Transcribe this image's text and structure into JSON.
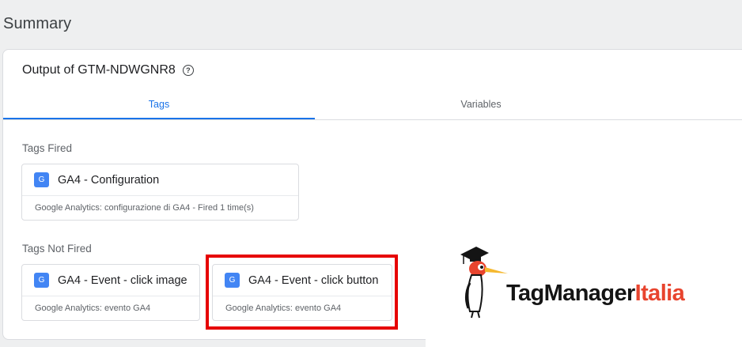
{
  "page_title": "Summary",
  "panel": {
    "header": "Output of GTM-NDWGNR8",
    "help_icon": "help-circle-icon"
  },
  "tabs": [
    {
      "label": "Tags",
      "active": true
    },
    {
      "label": "Variables",
      "active": false
    }
  ],
  "tags_fired": {
    "label": "Tags Fired",
    "items": [
      {
        "icon": "G",
        "name": "GA4 - Configuration",
        "subtitle": "Google Analytics: configurazione di GA4 - Fired 1 time(s)"
      }
    ]
  },
  "tags_not_fired": {
    "label": "Tags Not Fired",
    "items": [
      {
        "icon": "G",
        "name": "GA4 - Event - click image",
        "subtitle": "Google Analytics: evento GA4"
      },
      {
        "icon": "G",
        "name": "GA4 - Event - click button",
        "subtitle": "Google Analytics: evento GA4",
        "highlighted": true
      }
    ]
  },
  "watermark": {
    "brand_part1": "TagManager",
    "brand_part2": "Italia",
    "colors": {
      "part1": "#141414",
      "part2": "#e8442e"
    }
  },
  "colors": {
    "accent": "#1a73e8",
    "g_icon": "#4285f4",
    "highlight_border": "#e60000"
  }
}
